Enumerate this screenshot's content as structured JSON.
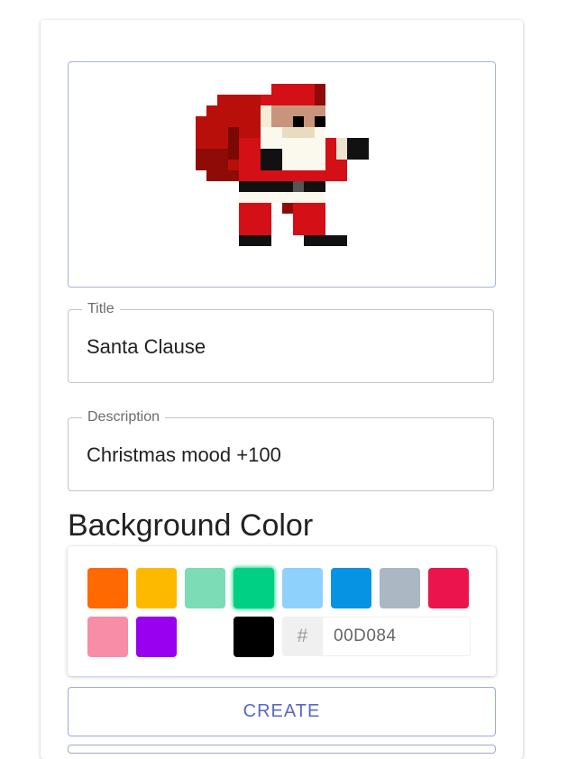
{
  "form": {
    "title_label": "Title",
    "title_value": "Santa Clause",
    "description_label": "Description",
    "description_value": "Christmas mood +100"
  },
  "background": {
    "heading": "Background Color",
    "swatches": [
      {
        "color": "#FF6900",
        "name": "orange"
      },
      {
        "color": "#FCB900",
        "name": "yellow"
      },
      {
        "color": "#7BDCB5",
        "name": "light-green"
      },
      {
        "color": "#00D084",
        "name": "green",
        "selected": true
      },
      {
        "color": "#8ED1FC",
        "name": "light-blue"
      },
      {
        "color": "#0693E3",
        "name": "blue"
      },
      {
        "color": "#ABB8C3",
        "name": "gray"
      },
      {
        "color": "#EB144C",
        "name": "red"
      },
      {
        "color": "#F78DA7",
        "name": "pink"
      },
      {
        "color": "#9900EF",
        "name": "purple"
      },
      {
        "color": "#FFFFFF",
        "name": "white"
      },
      {
        "color": "#000000",
        "name": "black"
      }
    ],
    "hex_prefix": "#",
    "hex_value": "00D084"
  },
  "actions": {
    "create_label": "CREATE"
  },
  "preview": {
    "image": "pixel-art-santa"
  }
}
